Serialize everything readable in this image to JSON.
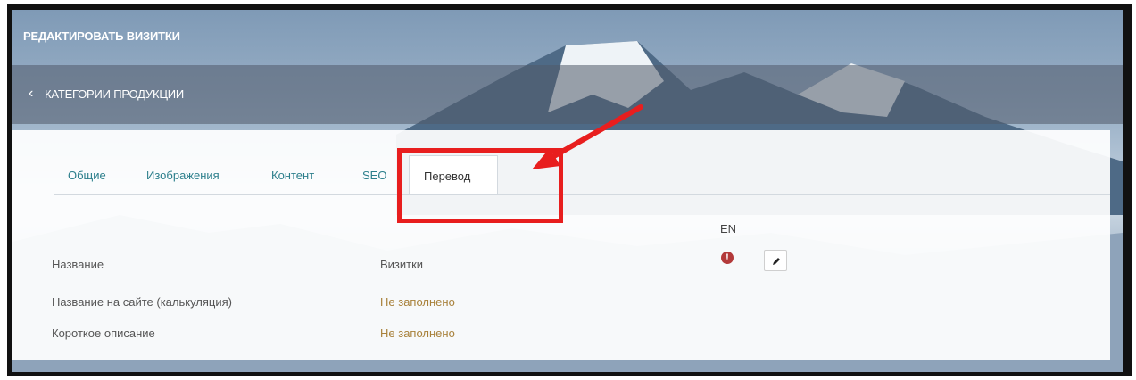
{
  "header": {
    "title": "РЕДАКТИРОВАТЬ ВИЗИТКИ"
  },
  "subheader": {
    "back_label": "КАТЕГОРИИ ПРОДУКЦИИ",
    "back_icon": "chevron-left-icon"
  },
  "tabs": [
    {
      "label": "Общие",
      "active": false
    },
    {
      "label": "Изображения",
      "active": false
    },
    {
      "label": "Контент",
      "active": false
    },
    {
      "label": "SEO",
      "active": false
    },
    {
      "label": "Перевод",
      "active": true
    }
  ],
  "translation": {
    "language": "EN",
    "status_icon": "exclamation-circle-icon",
    "edit_icon": "pencil-icon",
    "rows": [
      {
        "label": "Название",
        "value": "Визитки",
        "filled": true
      },
      {
        "label": "Название на сайте (калькуляция)",
        "value": "Не заполнено",
        "filled": false
      },
      {
        "label": "Короткое описание",
        "value": "Не заполнено",
        "filled": false
      }
    ]
  },
  "colors": {
    "tab_link": "#2c7f8c",
    "empty_value": "#a8813a",
    "error": "#b33a3a",
    "highlight": "#e81e1e"
  }
}
